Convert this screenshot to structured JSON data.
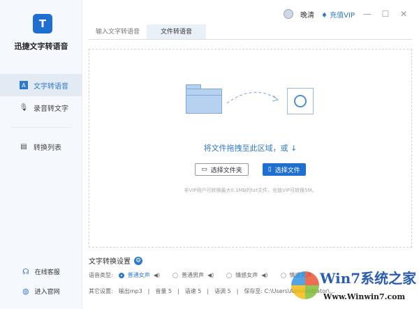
{
  "app": {
    "name": "迅捷文字转语音",
    "logo_letter": "T"
  },
  "sidebar": {
    "items": [
      {
        "label": "文字转语音",
        "icon": "A"
      },
      {
        "label": "录音转文字",
        "icon": "🎙"
      },
      {
        "label": "转换列表",
        "icon": "▤"
      }
    ],
    "footer": [
      {
        "label": "在线客服",
        "icon": "☊"
      },
      {
        "label": "进入官网",
        "icon": "◍"
      }
    ]
  },
  "titlebar": {
    "user": "晚清",
    "vip": "充值VIP",
    "vip_icon": "♦",
    "min": "—",
    "max": "☐",
    "close": "✕"
  },
  "tabs": [
    "输入文字转语音",
    "文件转语音"
  ],
  "drop": {
    "text": "将文件拖拽至此区域，或 ↓",
    "folder_button": "选择文件夹",
    "file_button": "选择文件",
    "hint": "非VIP用户可转换最大0.1MB的txt文件，充值VIP可转换5M。"
  },
  "settings": {
    "title": "文字转换设置",
    "voice_label": "语音类型:",
    "voices": [
      "普通女声",
      "普通男声",
      "情感女声",
      "情感男声"
    ],
    "selected_voice": "普通女声",
    "other_label": "其它设置:",
    "other": [
      "输出mp3",
      "音量 5",
      "语速 5",
      "语调 5",
      "保存至: C:\\Users\\Administrator\\..."
    ]
  },
  "watermark": {
    "line1": "Win7系统之家",
    "line2": "Www.Winwin7.com"
  }
}
